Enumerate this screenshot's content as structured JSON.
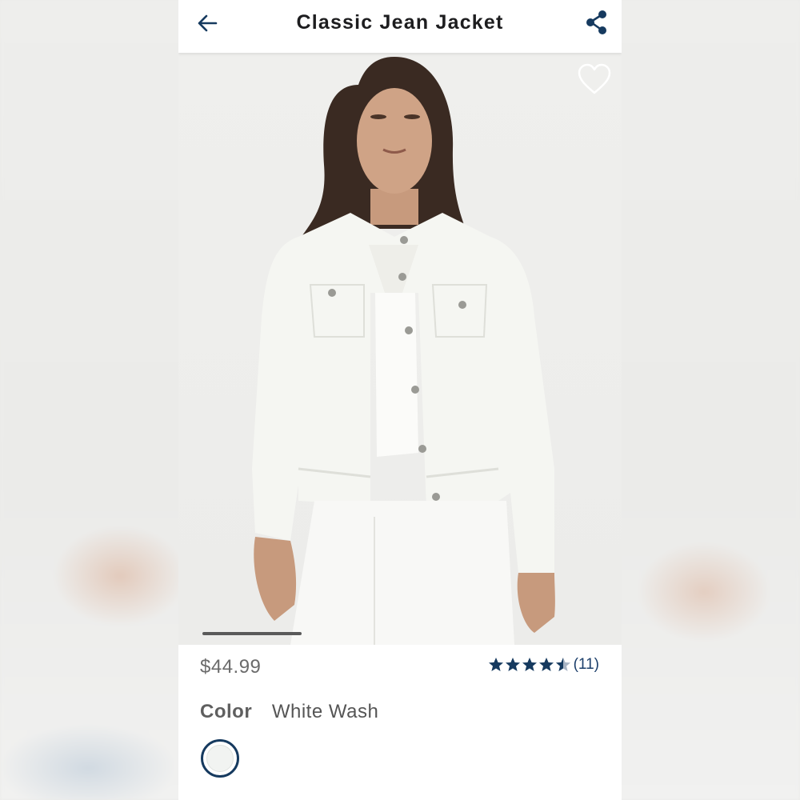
{
  "header": {
    "title": "Classic Jean Jacket",
    "back_icon": "arrow-left-icon",
    "share_icon": "share-icon"
  },
  "hero": {
    "favorite_icon": "heart-outline-icon",
    "image_progress": 0.22
  },
  "product": {
    "price": "$44.99",
    "rating": 4.5,
    "rating_max": 5,
    "review_count": "(11)",
    "color_label": "Color",
    "color_value": "White Wash"
  },
  "colors": {
    "accent": "#163a5f",
    "star": "#163a5f"
  }
}
